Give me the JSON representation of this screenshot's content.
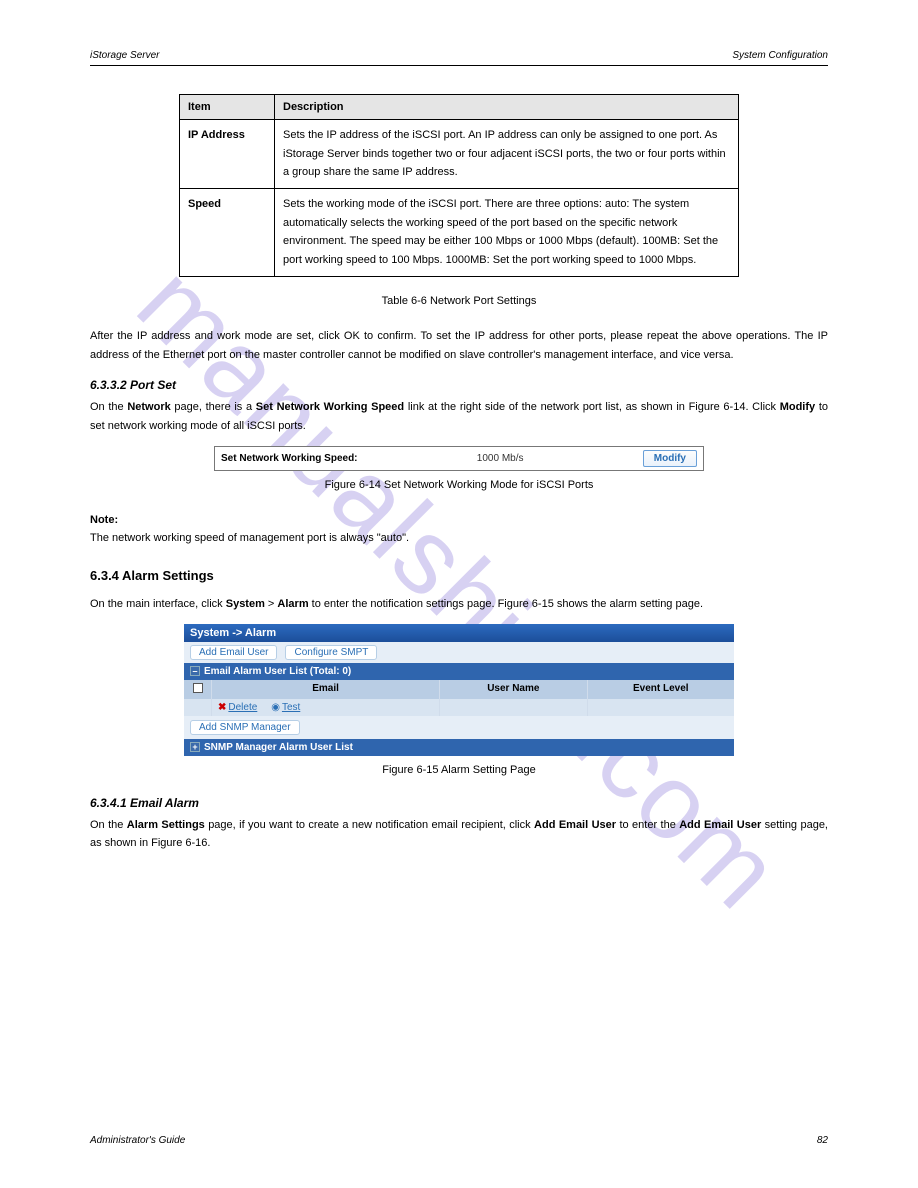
{
  "watermark": "manualshive.com",
  "header": {
    "left": "iStorage Server",
    "right": "System Configuration"
  },
  "defTable": {
    "col1": "Item",
    "col2": "Description",
    "rows": [
      {
        "item": "IP Address",
        "desc": "Sets the IP address of the iSCSI port. An IP address can only be assigned to one port. As iStorage Server binds together two or four adjacent iSCSI ports, the two or four ports within a group share the same IP address."
      },
      {
        "item": "Speed",
        "desc": "Sets the working mode of the iSCSI port. There are three options: auto: The system automatically selects the working speed of the port based on the specific network environment. The speed may be either 100 Mbps or 1000 Mbps (default). 100MB: Set the port working speed to 100 Mbps. 1000MB: Set the port working speed to 1000 Mbps."
      }
    ]
  },
  "tableCaption": "Table 6-6 Network Port Settings",
  "body": {
    "afterTable": "After the IP address and work mode are set, click OK to confirm. To set the IP address for other ports, please repeat the above operations. The IP address of the Ethernet port on the master controller cannot be modified on slave controller's management interface, and vice versa.",
    "portSetHeading": "6.3.3.2 Port Set",
    "portSetIntro_pre": "On the ",
    "portSetIntro_bold1": "Network",
    "portSetIntro_mid1": " page, there is a ",
    "portSetIntro_bold2": "Set Network Working Speed",
    "portSetIntro_mid2": " link at the right side of the network port list, as shown in Figure 6-14. Click ",
    "portSetIntro_bold3": "Modify",
    "portSetIntro_post": " to set network working mode of all iSCSI ports.",
    "speedCaption": "Figure 6-14 Set Network Working Mode for iSCSI Ports",
    "noteLabel": "Note:",
    "noteBody": "The network working speed of management port is always \"auto\".",
    "alarmHeading": "6.3.4 Alarm Settings",
    "alarmIntro_pre": "On the main interface, click ",
    "alarmIntro_bold1": "System",
    "alarmIntro_mid1": " > ",
    "alarmIntro_bold2": "Alarm",
    "alarmIntro_post": " to enter the notification settings page. Figure 6-15 shows the alarm setting page.",
    "alarmCaption": "Figure 6-15 Alarm Setting Page",
    "emailHeading": "6.3.4.1 Email Alarm",
    "emailBody_pre": "On the ",
    "emailBody_bold1": "Alarm Settings",
    "emailBody_mid1": " page, if you want to create a new notification email recipient, click ",
    "emailBody_bold2": "Add Email User",
    "emailBody_mid2": " to enter the ",
    "emailBody_bold3": "Add Email User",
    "emailBody_post": " setting page, as shown in Figure 6-16."
  },
  "speedPanel": {
    "label": "Set Network Working Speed:",
    "value": "1000 Mb/s",
    "button": "Modify"
  },
  "alarmPanel": {
    "title": "System -> Alarm",
    "addEmail": "Add Email User",
    "cfgSmtp": "Configure SMPT",
    "listHeader": "Email Alarm User List     (Total: 0)",
    "colEmail": "Email",
    "colUser": "User Name",
    "colEvent": "Event Level",
    "delete": "Delete",
    "test": "Test",
    "addSnmp": "Add SNMP Manager",
    "snmpHeader": "SNMP Manager Alarm User List"
  },
  "footer": {
    "left": "Administrator's Guide",
    "right": "82"
  }
}
